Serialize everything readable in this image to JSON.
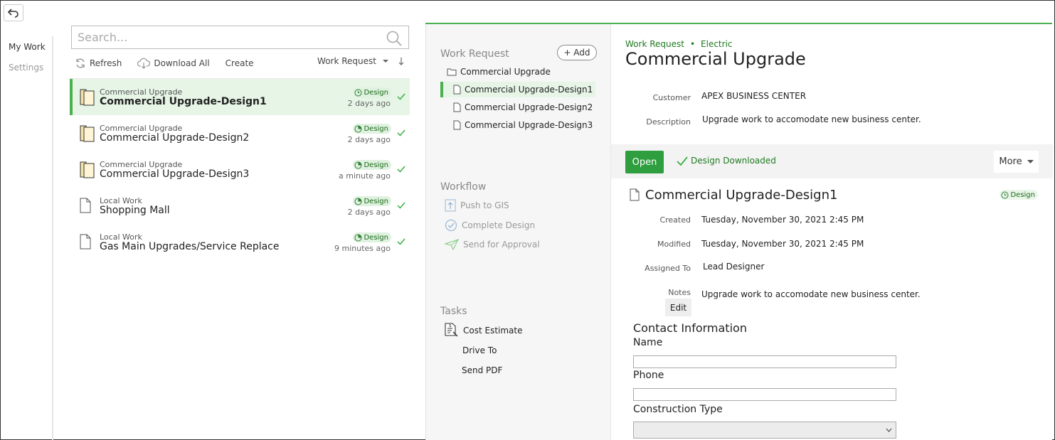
{
  "nav": {
    "my_work": "My Work",
    "settings": "Settings"
  },
  "search": {
    "placeholder": "Search..."
  },
  "toolbar": {
    "refresh": "Refresh",
    "download_all": "Download All",
    "create": "Create",
    "filter": "Work Request"
  },
  "work_list": [
    {
      "sub": "Commercial Upgrade",
      "title": "Commercial Upgrade-Design1",
      "badge": "Design",
      "time": "2 days ago"
    },
    {
      "sub": "Commercial Upgrade",
      "title": "Commercial Upgrade-Design2",
      "badge": "Design",
      "time": "2 days ago"
    },
    {
      "sub": "Commercial Upgrade",
      "title": "Commercial Upgrade-Design3",
      "badge": "Design",
      "time": "a minute ago"
    },
    {
      "sub": "Local Work",
      "title": "Shopping Mall",
      "badge": "Design",
      "time": "2 days ago"
    },
    {
      "sub": "Local Work",
      "title": "Gas Main Upgrades/Service Replace",
      "badge": "Design",
      "time": "9 minutes ago"
    }
  ],
  "middle": {
    "work_request_heading": "Work Request",
    "add_label": "+ Add",
    "tree": {
      "folder": "Commercial Upgrade",
      "items": [
        "Commercial Upgrade-Design1",
        "Commercial Upgrade-Design2",
        "Commercial Upgrade-Design3"
      ]
    },
    "workflow_heading": "Workflow",
    "workflow": [
      "Push to GIS",
      "Complete Design",
      "Send for Approval"
    ],
    "tasks_heading": "Tasks",
    "tasks": [
      "Cost Estimate",
      "Drive To",
      "Send PDF"
    ]
  },
  "detail": {
    "breadcrumb": [
      "Work Request",
      "Electric"
    ],
    "title": "Commercial Upgrade",
    "customer_label": "Customer",
    "customer": "APEX BUSINESS CENTER",
    "description_label": "Description",
    "description": "Upgrade work to accomodate new business center.",
    "open_label": "Open",
    "download_status": "Design Downloaded",
    "more_label": "More",
    "design_title": "Commercial Upgrade-Design1",
    "design_badge": "Design",
    "created_label": "Created",
    "created": "Tuesday, November 30, 2021 2:45 PM",
    "modified_label": "Modified",
    "modified": "Tuesday, November 30, 2021 2:45 PM",
    "assigned_label": "Assigned To",
    "assigned": "Lead Designer",
    "notes_label": "Notes",
    "notes": "Upgrade work to accomodate new business center.",
    "edit_label": "Edit",
    "contact_heading": "Contact Information",
    "name_label": "Name",
    "phone_label": "Phone",
    "construction_label": "Construction Type"
  },
  "colors": {
    "accent": "#4caf50",
    "accent_dark": "#2e9e3e",
    "selected_bg": "#e6f5e6"
  }
}
